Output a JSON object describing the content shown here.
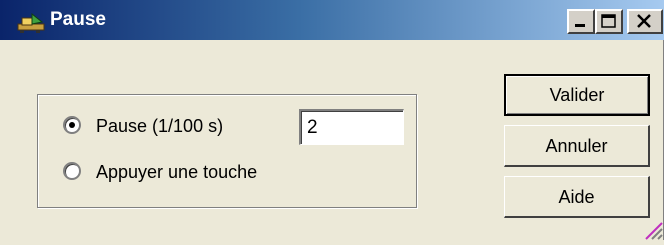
{
  "window": {
    "title": "Pause",
    "title_icon": "app-icon",
    "controls": {
      "minimize_icon": "minimize-icon",
      "maximize_icon": "maximize-icon",
      "close_icon": "close-icon"
    }
  },
  "options": {
    "pause_label": "Pause (1/100 s)",
    "pause_selected": true,
    "pause_value": "2",
    "keypress_label": "Appuyer une touche",
    "keypress_selected": false
  },
  "buttons": {
    "validate": "Valider",
    "cancel": "Annuler",
    "help": "Aide"
  },
  "colors": {
    "titlebar_start": "#0a246a",
    "titlebar_end": "#a6caf0",
    "face": "#ece9d8",
    "grip_accent": "#c030c0"
  }
}
